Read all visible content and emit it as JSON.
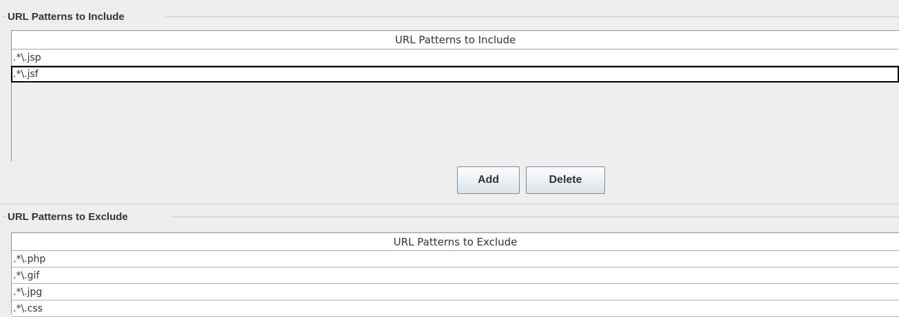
{
  "include": {
    "title": "URL Patterns to Include",
    "column_header": "URL Patterns to Include",
    "rows": [
      ".*\\.jsp",
      ".*\\.jsf"
    ],
    "selected_row": 1
  },
  "buttons": {
    "add_label": "Add",
    "delete_label": "Delete"
  },
  "exclude": {
    "title": "URL Patterns to Exclude",
    "column_header": "URL Patterns to Exclude",
    "rows": [
      ".*\\.php",
      ".*\\.gif",
      ".*\\.jpg",
      ".*\\.css"
    ]
  },
  "colors": {
    "panel_background": "#eeeeee",
    "row_background": "#ffffff",
    "selection_border": "#000000"
  }
}
